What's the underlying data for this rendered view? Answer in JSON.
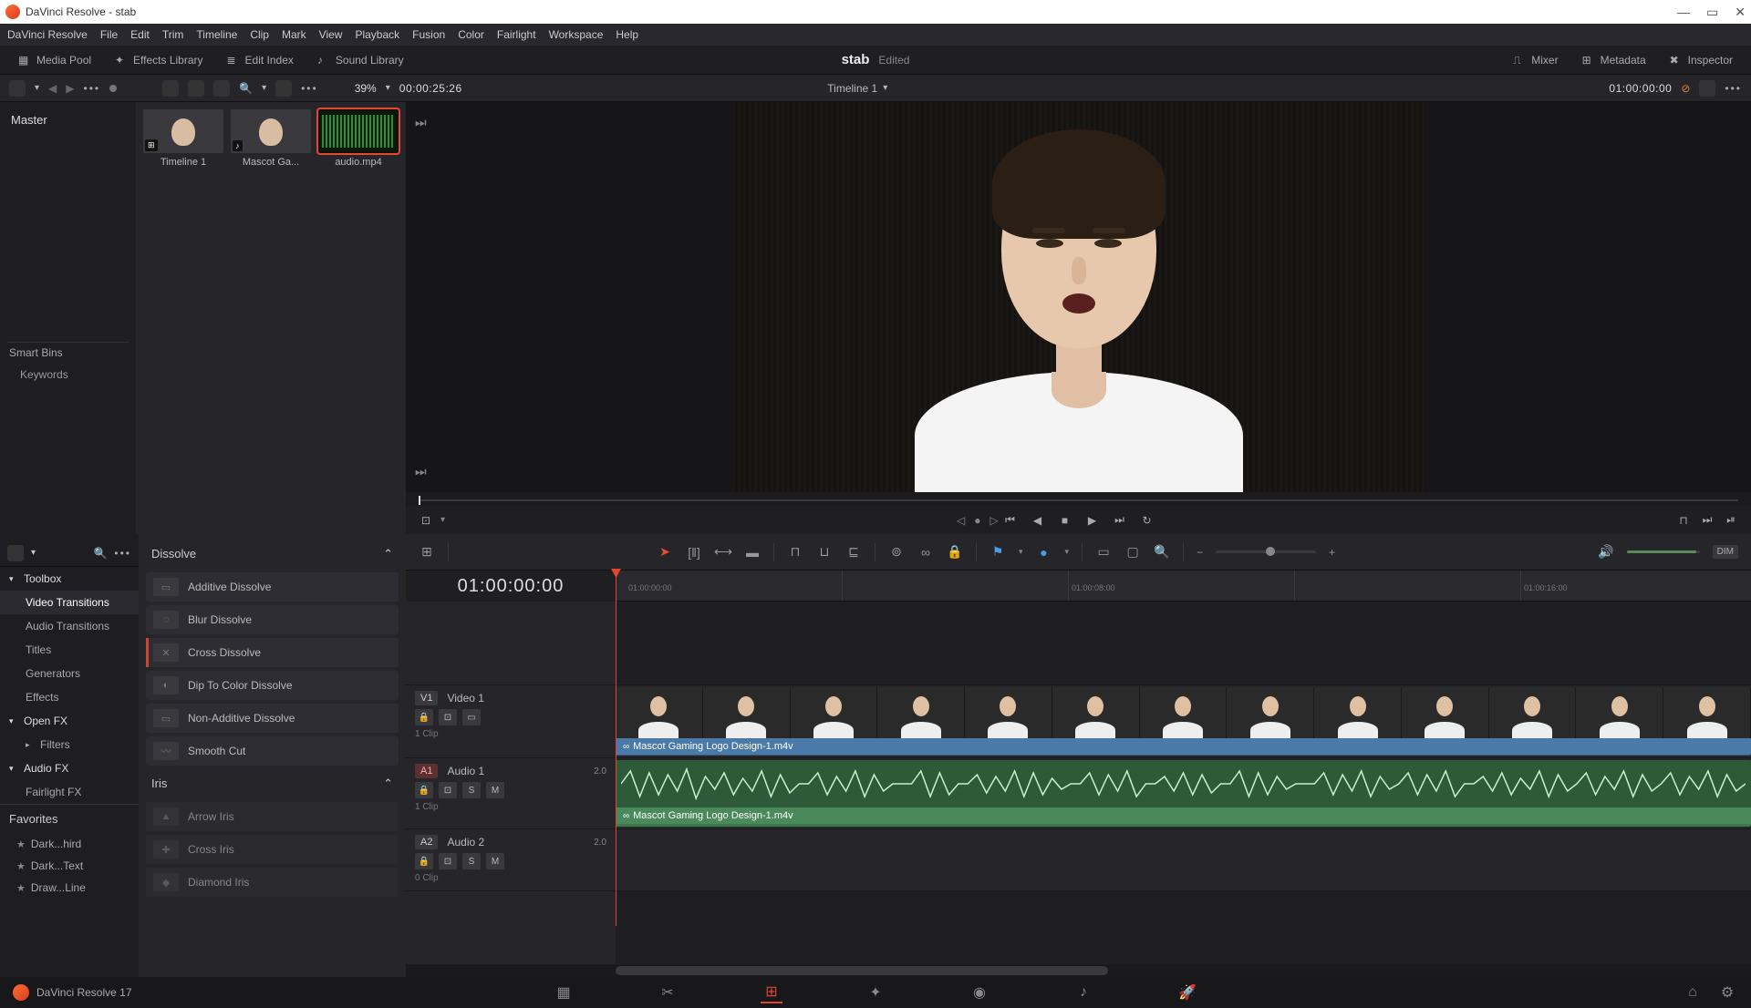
{
  "titlebar": {
    "title": "DaVinci Resolve - stab"
  },
  "menu": {
    "items": [
      "DaVinci Resolve",
      "File",
      "Edit",
      "Trim",
      "Timeline",
      "Clip",
      "Mark",
      "View",
      "Playback",
      "Fusion",
      "Color",
      "Fairlight",
      "Workspace",
      "Help"
    ]
  },
  "toolbar": {
    "media_pool": "Media Pool",
    "effects_library": "Effects Library",
    "edit_index": "Edit Index",
    "sound_library": "Sound Library",
    "mixer": "Mixer",
    "metadata": "Metadata",
    "inspector": "Inspector",
    "project_title": "stab",
    "project_status": "Edited"
  },
  "toolbar2": {
    "zoom": "39%",
    "source_tc": "00:00:25:26",
    "timeline_name": "Timeline 1",
    "record_tc": "01:00:00:00"
  },
  "bins": {
    "master": "Master",
    "smart_bins": "Smart Bins",
    "keywords": "Keywords"
  },
  "clips": [
    {
      "label": "Timeline 1",
      "kind": "timeline"
    },
    {
      "label": "Mascot Ga...",
      "kind": "video"
    },
    {
      "label": "audio.mp4",
      "kind": "audio",
      "selected": true
    }
  ],
  "fx_tree": {
    "toolbox": "Toolbox",
    "video_transitions": "Video Transitions",
    "audio_transitions": "Audio Transitions",
    "titles": "Titles",
    "generators": "Generators",
    "effects": "Effects",
    "openfx": "Open FX",
    "filters": "Filters",
    "audiofx": "Audio FX",
    "fairlightfx": "Fairlight FX",
    "favorites": "Favorites",
    "fav_items": [
      "Dark...hird",
      "Dark...Text",
      "Draw...Line"
    ]
  },
  "fx_list": {
    "group_dissolve": "Dissolve",
    "dissolve_items": [
      "Additive Dissolve",
      "Blur Dissolve",
      "Cross Dissolve",
      "Dip To Color Dissolve",
      "Non-Additive Dissolve",
      "Smooth Cut"
    ],
    "group_iris": "Iris",
    "iris_items": [
      "Arrow Iris",
      "Cross Iris",
      "Diamond Iris"
    ]
  },
  "timeline": {
    "playhead_tc": "01:00:00:00",
    "ruler_labels": [
      "01:00:00:00",
      "01:00:08:00",
      "01:00:16:00"
    ],
    "video": {
      "tag": "V1",
      "name": "Video 1",
      "clip_count": "1 Clip",
      "clip_name": "Mascot Gaming Logo Design-1.m4v"
    },
    "audio1": {
      "tag": "A1",
      "name": "Audio 1",
      "channels": "2.0",
      "solo": "S",
      "mute": "M",
      "clip_count": "1 Clip",
      "clip_name": "Mascot Gaming Logo Design-1.m4v"
    },
    "audio2": {
      "tag": "A2",
      "name": "Audio 2",
      "channels": "2.0",
      "solo": "S",
      "mute": "M",
      "clip_count": "0 Clip"
    },
    "dim": "DIM"
  },
  "bottom": {
    "version": "DaVinci Resolve 17"
  }
}
